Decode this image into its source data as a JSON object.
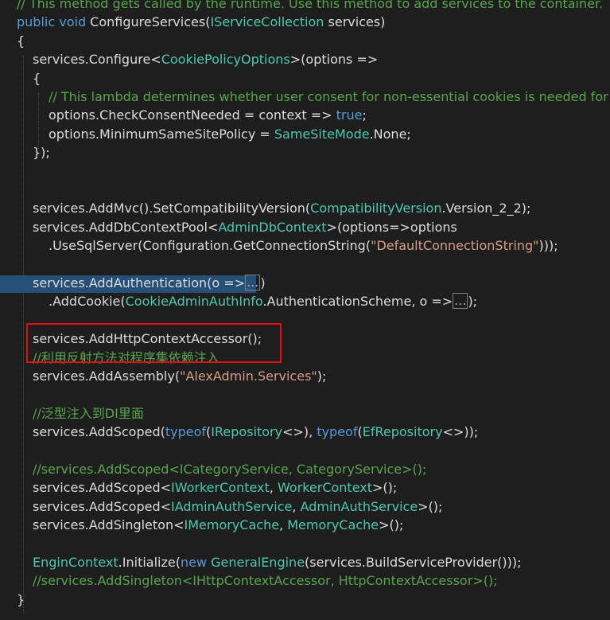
{
  "editor": {
    "lines": [
      {
        "indent": 0,
        "tokens": [
          {
            "t": "// This method gets called by the runtime. Use this method to add services to the container.",
            "c": "cmt"
          }
        ]
      },
      {
        "indent": 0,
        "tokens": [
          {
            "t": "public",
            "c": "kw"
          },
          {
            "t": " ",
            "c": "plain"
          },
          {
            "t": "void",
            "c": "kw"
          },
          {
            "t": " ConfigureServices(",
            "c": "plain"
          },
          {
            "t": "IServiceCollection",
            "c": "type"
          },
          {
            "t": " services)",
            "c": "plain"
          }
        ]
      },
      {
        "indent": 0,
        "tokens": [
          {
            "t": "{",
            "c": "plain"
          }
        ]
      },
      {
        "indent": 1,
        "tokens": [
          {
            "t": "services.Configure<",
            "c": "plain"
          },
          {
            "t": "CookiePolicyOptions",
            "c": "type"
          },
          {
            "t": ">(options =>",
            "c": "plain"
          }
        ]
      },
      {
        "indent": 1,
        "tokens": [
          {
            "t": "{",
            "c": "plain"
          }
        ]
      },
      {
        "indent": 2,
        "tokens": [
          {
            "t": "// This lambda determines whether user consent for non-essential cookies is needed for",
            "c": "cmt"
          }
        ]
      },
      {
        "indent": 2,
        "tokens": [
          {
            "t": "options.CheckConsentNeeded = context => ",
            "c": "plain"
          },
          {
            "t": "true",
            "c": "kw"
          },
          {
            "t": ";",
            "c": "plain"
          }
        ]
      },
      {
        "indent": 2,
        "tokens": [
          {
            "t": "options.MinimumSameSitePolicy = ",
            "c": "plain"
          },
          {
            "t": "SameSiteMode",
            "c": "type"
          },
          {
            "t": ".None;",
            "c": "plain"
          }
        ]
      },
      {
        "indent": 1,
        "tokens": [
          {
            "t": "});",
            "c": "plain"
          }
        ]
      },
      {
        "indent": 0,
        "tokens": []
      },
      {
        "indent": 0,
        "tokens": []
      },
      {
        "indent": 1,
        "tokens": [
          {
            "t": "services.AddMvc().SetCompatibilityVersion(",
            "c": "plain"
          },
          {
            "t": "CompatibilityVersion",
            "c": "type"
          },
          {
            "t": ".Version_2_2);",
            "c": "plain"
          }
        ]
      },
      {
        "indent": 1,
        "tokens": [
          {
            "t": "services.AddDbContextPool<",
            "c": "plain"
          },
          {
            "t": "AdminDbContext",
            "c": "type"
          },
          {
            "t": ">(options=>options",
            "c": "plain"
          }
        ]
      },
      {
        "indent": 2,
        "tokens": [
          {
            "t": ".UseSqlServer(Configuration.GetConnectionString(",
            "c": "plain"
          },
          {
            "t": "\"DefaultConnectionString\"",
            "c": "str"
          },
          {
            "t": ")));",
            "c": "plain"
          }
        ]
      },
      {
        "indent": 0,
        "tokens": []
      },
      {
        "indent": 1,
        "selected": true,
        "tokens": [
          {
            "t": "services.AddAuthentication(o =>",
            "c": "plain"
          },
          {
            "t": "...",
            "c": "collapsed"
          },
          {
            "t": ")",
            "c": "plain"
          }
        ]
      },
      {
        "indent": 2,
        "tokens": [
          {
            "t": ".AddCookie(",
            "c": "plain"
          },
          {
            "t": "CookieAdminAuthInfo",
            "c": "type"
          },
          {
            "t": ".AuthenticationScheme, o =>",
            "c": "plain"
          },
          {
            "t": "...",
            "c": "collapsed"
          },
          {
            "t": ");",
            "c": "plain"
          }
        ]
      },
      {
        "indent": 0,
        "tokens": []
      },
      {
        "indent": 1,
        "tokens": [
          {
            "t": "services.AddHttpContextAccessor();",
            "c": "plain"
          }
        ]
      },
      {
        "indent": 1,
        "tokens": [
          {
            "t": "//利用反射方法对程序集依赖注入",
            "c": "cmt"
          }
        ]
      },
      {
        "indent": 1,
        "tokens": [
          {
            "t": "services.AddAssembly(",
            "c": "plain"
          },
          {
            "t": "\"AlexAdmin.Services\"",
            "c": "str"
          },
          {
            "t": ");",
            "c": "plain"
          }
        ]
      },
      {
        "indent": 0,
        "tokens": []
      },
      {
        "indent": 1,
        "tokens": [
          {
            "t": "//泛型注入到DI里面",
            "c": "cmt"
          }
        ]
      },
      {
        "indent": 1,
        "tokens": [
          {
            "t": "services.AddScoped(",
            "c": "plain"
          },
          {
            "t": "typeof",
            "c": "kw"
          },
          {
            "t": "(",
            "c": "plain"
          },
          {
            "t": "IRepository",
            "c": "type"
          },
          {
            "t": "<>), ",
            "c": "plain"
          },
          {
            "t": "typeof",
            "c": "kw"
          },
          {
            "t": "(",
            "c": "plain"
          },
          {
            "t": "EfRepository",
            "c": "type"
          },
          {
            "t": "<>));",
            "c": "plain"
          }
        ]
      },
      {
        "indent": 0,
        "tokens": []
      },
      {
        "indent": 1,
        "tokens": [
          {
            "t": "//services.AddScoped<ICategoryService, CategoryService>();",
            "c": "cmt"
          }
        ]
      },
      {
        "indent": 1,
        "tokens": [
          {
            "t": "services.AddScoped<",
            "c": "plain"
          },
          {
            "t": "IWorkerContext",
            "c": "type"
          },
          {
            "t": ", ",
            "c": "plain"
          },
          {
            "t": "WorkerContext",
            "c": "type"
          },
          {
            "t": ">();",
            "c": "plain"
          }
        ]
      },
      {
        "indent": 1,
        "tokens": [
          {
            "t": "services.AddScoped<",
            "c": "plain"
          },
          {
            "t": "IAdminAuthService",
            "c": "type"
          },
          {
            "t": ", ",
            "c": "plain"
          },
          {
            "t": "AdminAuthService",
            "c": "type"
          },
          {
            "t": ">();",
            "c": "plain"
          }
        ]
      },
      {
        "indent": 1,
        "tokens": [
          {
            "t": "services.AddSingleton<",
            "c": "plain"
          },
          {
            "t": "IMemoryCache",
            "c": "type"
          },
          {
            "t": ", ",
            "c": "plain"
          },
          {
            "t": "MemoryCache",
            "c": "type"
          },
          {
            "t": ">();",
            "c": "plain"
          }
        ]
      },
      {
        "indent": 0,
        "tokens": []
      },
      {
        "indent": 1,
        "tokens": [
          {
            "t": "EnginContext",
            "c": "type"
          },
          {
            "t": ".Initialize(",
            "c": "plain"
          },
          {
            "t": "new",
            "c": "kw"
          },
          {
            "t": " ",
            "c": "plain"
          },
          {
            "t": "GeneralEngine",
            "c": "type"
          },
          {
            "t": "(services.BuildServiceProvider()));",
            "c": "plain"
          }
        ]
      },
      {
        "indent": 1,
        "tokens": [
          {
            "t": "//services.AddSingleton<IHttpContextAccessor, HttpContextAccessor>();",
            "c": "cmt"
          }
        ]
      },
      {
        "indent": 0,
        "tokens": [
          {
            "t": "}",
            "c": "plain"
          }
        ]
      }
    ],
    "annotation_line": 18
  }
}
